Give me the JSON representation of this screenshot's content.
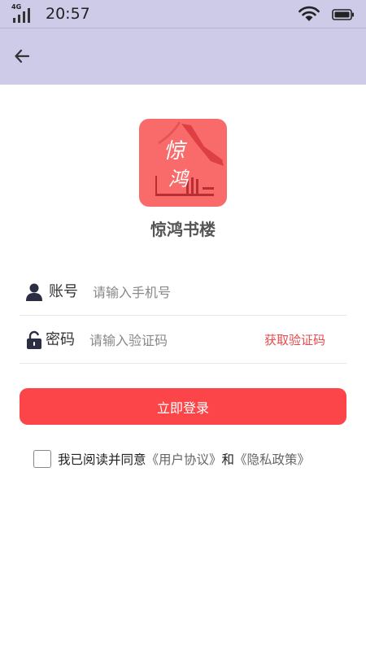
{
  "status_bar": {
    "network": "4G",
    "time": "20:57"
  },
  "header": {
    "back_icon": "arrow-left-icon"
  },
  "logo": {
    "calligraphy_1": "惊",
    "calligraphy_2": "鸿"
  },
  "app_name": "惊鸿书楼",
  "form": {
    "account": {
      "icon": "user-icon",
      "label": "账号",
      "placeholder": "请输入手机号",
      "value": ""
    },
    "code": {
      "icon": "lock-icon",
      "label": "密码",
      "placeholder": "请输入验证码",
      "value": "",
      "get_code_label": "获取验证码"
    },
    "login_label": "立即登录"
  },
  "agreement": {
    "checked": false,
    "prefix": "我已阅读并同意",
    "user_agreement": "《用户协议》",
    "conjunction": "和",
    "privacy_policy": "《隐私政策》"
  },
  "colors": {
    "header_bg": "#cdcbe8",
    "accent": "#fc4548",
    "logo_bg": "#f96b6b"
  }
}
